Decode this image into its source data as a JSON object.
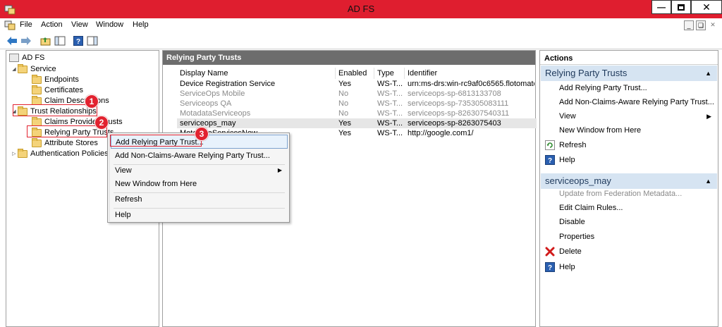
{
  "window": {
    "title": "AD FS"
  },
  "menu": {
    "items": [
      "File",
      "Action",
      "View",
      "Window",
      "Help"
    ]
  },
  "tree": {
    "root": "AD FS",
    "service": "Service",
    "endpoints": "Endpoints",
    "certificates": "Certificates",
    "claim_descriptions": "Claim Descriptions",
    "trust_relationships": "Trust Relationships",
    "claims_provider_trusts": "Claims Provider Trusts",
    "relying_party_trusts": "Relying Party Trusts",
    "attribute_stores": "Attribute Stores",
    "authentication_policies": "Authentication Policies"
  },
  "list": {
    "header": "Relying Party Trusts",
    "columns": [
      "Display Name",
      "Enabled",
      "Type",
      "Identifier"
    ],
    "rows": [
      {
        "name": "Device Registration Service",
        "enabled": "Yes",
        "type": "WS-T...",
        "identifier": "urn:ms-drs:win-rc9af0c6565.flotomate...."
      },
      {
        "name": "ServiceOps Mobile",
        "enabled": "No",
        "type": "WS-T...",
        "identifier": "serviceops-sp-6813133708"
      },
      {
        "name": "Serviceops QA",
        "enabled": "No",
        "type": "WS-T...",
        "identifier": "serviceops-sp-735305083111"
      },
      {
        "name": "MotadataServiceops",
        "enabled": "No",
        "type": "WS-T...",
        "identifier": "serviceops-sp-826307540311"
      },
      {
        "name": "serviceops_may",
        "enabled": "Yes",
        "type": "WS-T...",
        "identifier": "serviceops-sp-8263075403"
      },
      {
        "name": "MotadataServicesNow",
        "enabled": "Yes",
        "type": "WS-T...",
        "identifier": "http://google.com1/"
      }
    ]
  },
  "actions": {
    "title": "Actions",
    "section1": {
      "title": "Relying Party Trusts",
      "items": [
        "Add Relying Party Trust...",
        "Add Non-Claims-Aware Relying Party Trust...",
        "View",
        "New Window from Here",
        "Refresh",
        "Help"
      ]
    },
    "section2": {
      "title": "serviceops_may",
      "items": [
        "Update from Federation Metadata...",
        "Edit Claim Rules...",
        "Disable",
        "Properties",
        "Delete",
        "Help"
      ]
    }
  },
  "context_menu": {
    "items": [
      "Add Relying Party Trust...",
      "Add Non-Claims-Aware Relying Party Trust...",
      "View",
      "New Window from Here",
      "Refresh",
      "Help"
    ]
  },
  "annotations": {
    "step1": "1",
    "step2": "2",
    "step3": "3"
  },
  "colors": {
    "title_bar": "#df1e2f",
    "callout": "#e2222f",
    "section_bg": "#d6e4f2",
    "pane_header": "#6d6d6d"
  }
}
